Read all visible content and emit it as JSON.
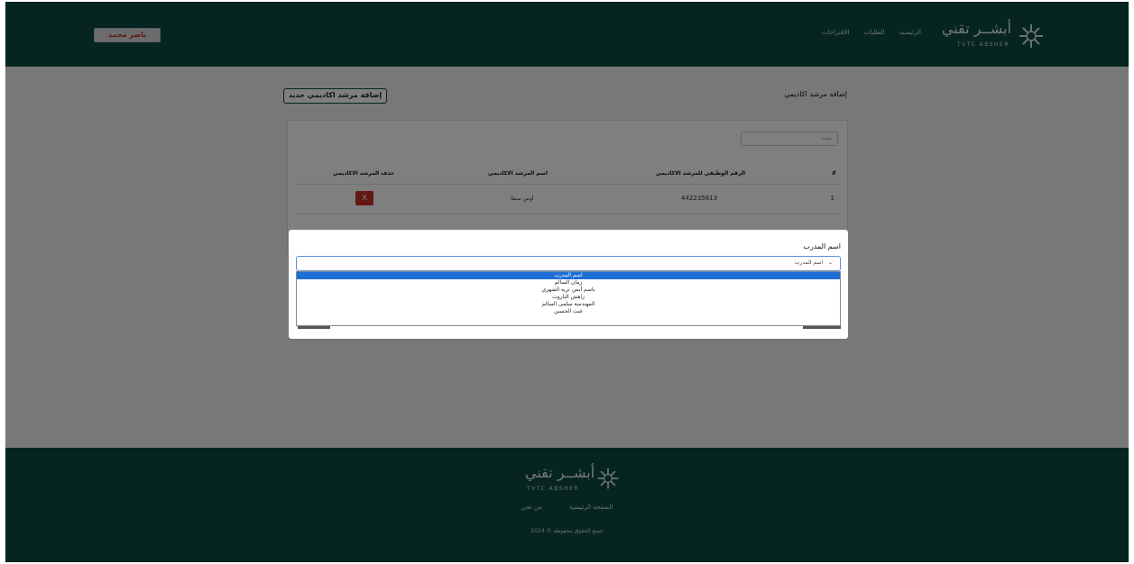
{
  "header": {
    "user_button": "ناصر محمد",
    "nav": [
      "الرئيسية",
      "الطلبات",
      "الاقتراحات"
    ],
    "logo_ar": "أبشــر تقني",
    "logo_en": "TVTC ABSHER"
  },
  "main": {
    "title": "إضافة مرشد اكاديمي",
    "add_button": "إضافة مرشد اكاديمي جديد",
    "search_placeholder": "بحث",
    "table": {
      "headers": [
        "#",
        "الرقم الوظيفي للمرشد الاكاديمي",
        "اسم المرشد الاكاديمي",
        "حذف المرشد الاكاديمي"
      ],
      "rows": [
        {
          "index": "1",
          "employee_id": "442235613",
          "name": "أوس سطا",
          "delete": "X"
        }
      ]
    }
  },
  "modal": {
    "label": "اسم المدرب",
    "select_value": "اسم المدرب",
    "options": [
      "اسم المدرب",
      "زمان السالم",
      "باسم أيمن نزيه الشهري",
      "زاهش الباروت",
      "المهندسة سلمى السالم",
      "غيث الحسين"
    ]
  },
  "footer": {
    "logo_ar": "أبشــر تقني",
    "logo_en": "TVTC ABSHER",
    "links": [
      "الصفحة الرئيسية",
      "من نحن"
    ],
    "copyright": "جميع الحقوق محفوظة © 2024"
  }
}
